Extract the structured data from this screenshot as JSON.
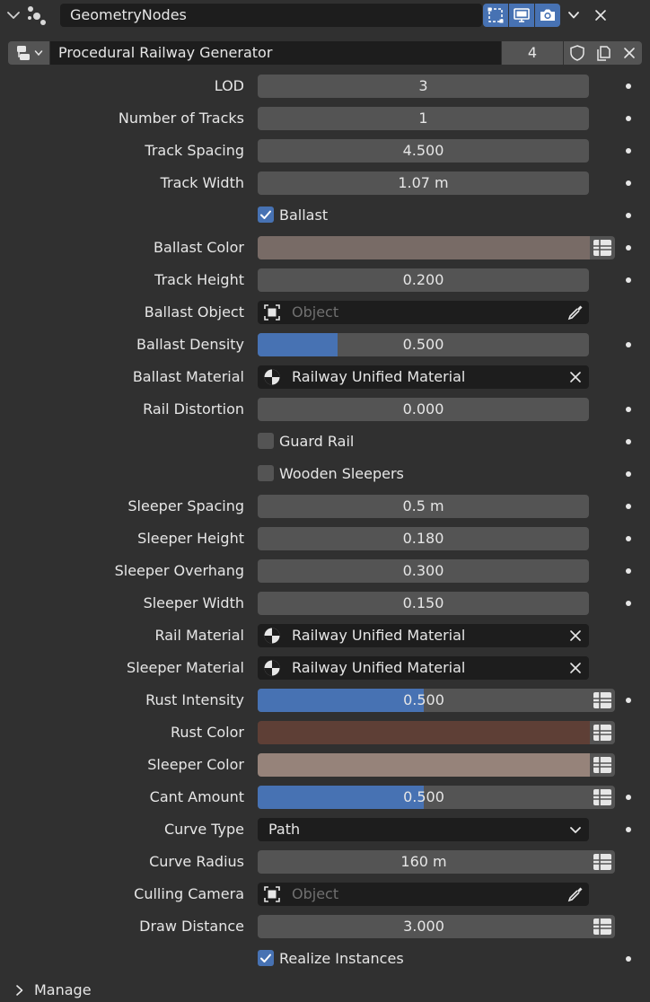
{
  "header": {
    "modifier_name": "GeometryNodes"
  },
  "node_group": {
    "name": "Procedural Railway Generator",
    "users": "4"
  },
  "props": {
    "lod": {
      "label": "LOD",
      "value": "3"
    },
    "num_tracks": {
      "label": "Number of Tracks",
      "value": "1"
    },
    "track_spacing": {
      "label": "Track Spacing",
      "value": "4.500"
    },
    "track_width": {
      "label": "Track Width",
      "value": "1.07 m"
    },
    "ballast": {
      "label": "Ballast",
      "checked": true
    },
    "ballast_color": {
      "label": "Ballast Color",
      "color": "#786b66"
    },
    "track_height": {
      "label": "Track Height",
      "value": "0.200"
    },
    "ballast_object": {
      "label": "Ballast Object",
      "placeholder": "Object"
    },
    "ballast_density": {
      "label": "Ballast Density",
      "value": "0.500",
      "fraction": 0.24
    },
    "ballast_material": {
      "label": "Ballast Material",
      "value": "Railway Unified Material"
    },
    "rail_distortion": {
      "label": "Rail Distortion",
      "value": "0.000"
    },
    "guard_rail": {
      "label": "Guard Rail",
      "checked": false
    },
    "wooden_sleepers": {
      "label": "Wooden Sleepers",
      "checked": false
    },
    "sleeper_spacing": {
      "label": "Sleeper Spacing",
      "value": "0.5 m"
    },
    "sleeper_height": {
      "label": "Sleeper Height",
      "value": "0.180"
    },
    "sleeper_overhang": {
      "label": "Sleeper Overhang",
      "value": "0.300"
    },
    "sleeper_width": {
      "label": "Sleeper Width",
      "value": "0.150"
    },
    "rail_material": {
      "label": "Rail Material",
      "value": "Railway Unified Material"
    },
    "sleeper_material": {
      "label": "Sleeper Material",
      "value": "Railway Unified Material"
    },
    "rust_intensity": {
      "label": "Rust Intensity",
      "value": "0.500",
      "fraction": 0.5
    },
    "rust_color": {
      "label": "Rust Color",
      "color": "#5e3f36"
    },
    "sleeper_color": {
      "label": "Sleeper Color",
      "color": "#96837a"
    },
    "cant_amount": {
      "label": "Cant Amount",
      "value": "0.500",
      "fraction": 0.5
    },
    "curve_type": {
      "label": "Curve Type",
      "value": "Path"
    },
    "curve_radius": {
      "label": "Curve Radius",
      "value": "160 m"
    },
    "culling_camera": {
      "label": "Culling Camera",
      "placeholder": "Object"
    },
    "draw_distance": {
      "label": "Draw Distance",
      "value": "3.000"
    },
    "realize_instances": {
      "label": "Realize Instances",
      "checked": true
    }
  },
  "footer": {
    "manage_label": "Manage"
  },
  "colors": {
    "accent": "#4772b3",
    "panel_bg": "#303030",
    "field_bg": "#545454",
    "dark_field_bg": "#1d1d1d"
  }
}
